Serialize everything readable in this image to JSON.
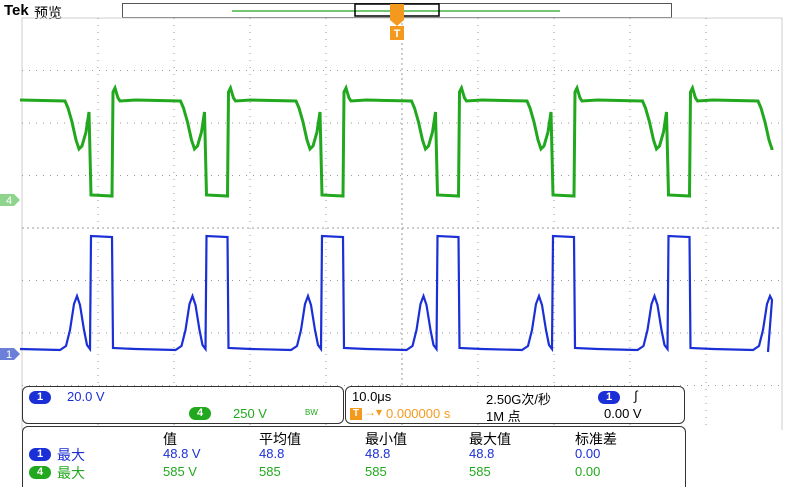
{
  "header": {
    "brand": "Tek",
    "mode": "预览"
  },
  "trigger_marker": "T",
  "channels": {
    "ch4": {
      "id": "4",
      "color": "#22a81e",
      "scale": "250 V",
      "bw_mark": "BW"
    },
    "ch1": {
      "id": "1",
      "color": "#1b2fd6",
      "scale": "20.0 V"
    }
  },
  "timebase": {
    "scale": "10.0μs",
    "sample_rate": "2.50G次/秒",
    "record_length": "1M 点",
    "trigger_delay": "0.000000 s",
    "trigger_channel": "1",
    "trigger_slope": "∫",
    "trigger_level": "0.00 V"
  },
  "measurements": {
    "headers": [
      "值",
      "平均值",
      "最小值",
      "最大值",
      "标准差"
    ],
    "rows": [
      {
        "channel": "1",
        "type": "最大",
        "value": "48.8 V",
        "mean": "48.8",
        "min": "48.8",
        "max": "48.8",
        "std": "0.00"
      },
      {
        "channel": "4",
        "type": "最大",
        "value": "585 V",
        "mean": "585",
        "min": "585",
        "max": "585",
        "std": "0.00"
      }
    ]
  }
}
